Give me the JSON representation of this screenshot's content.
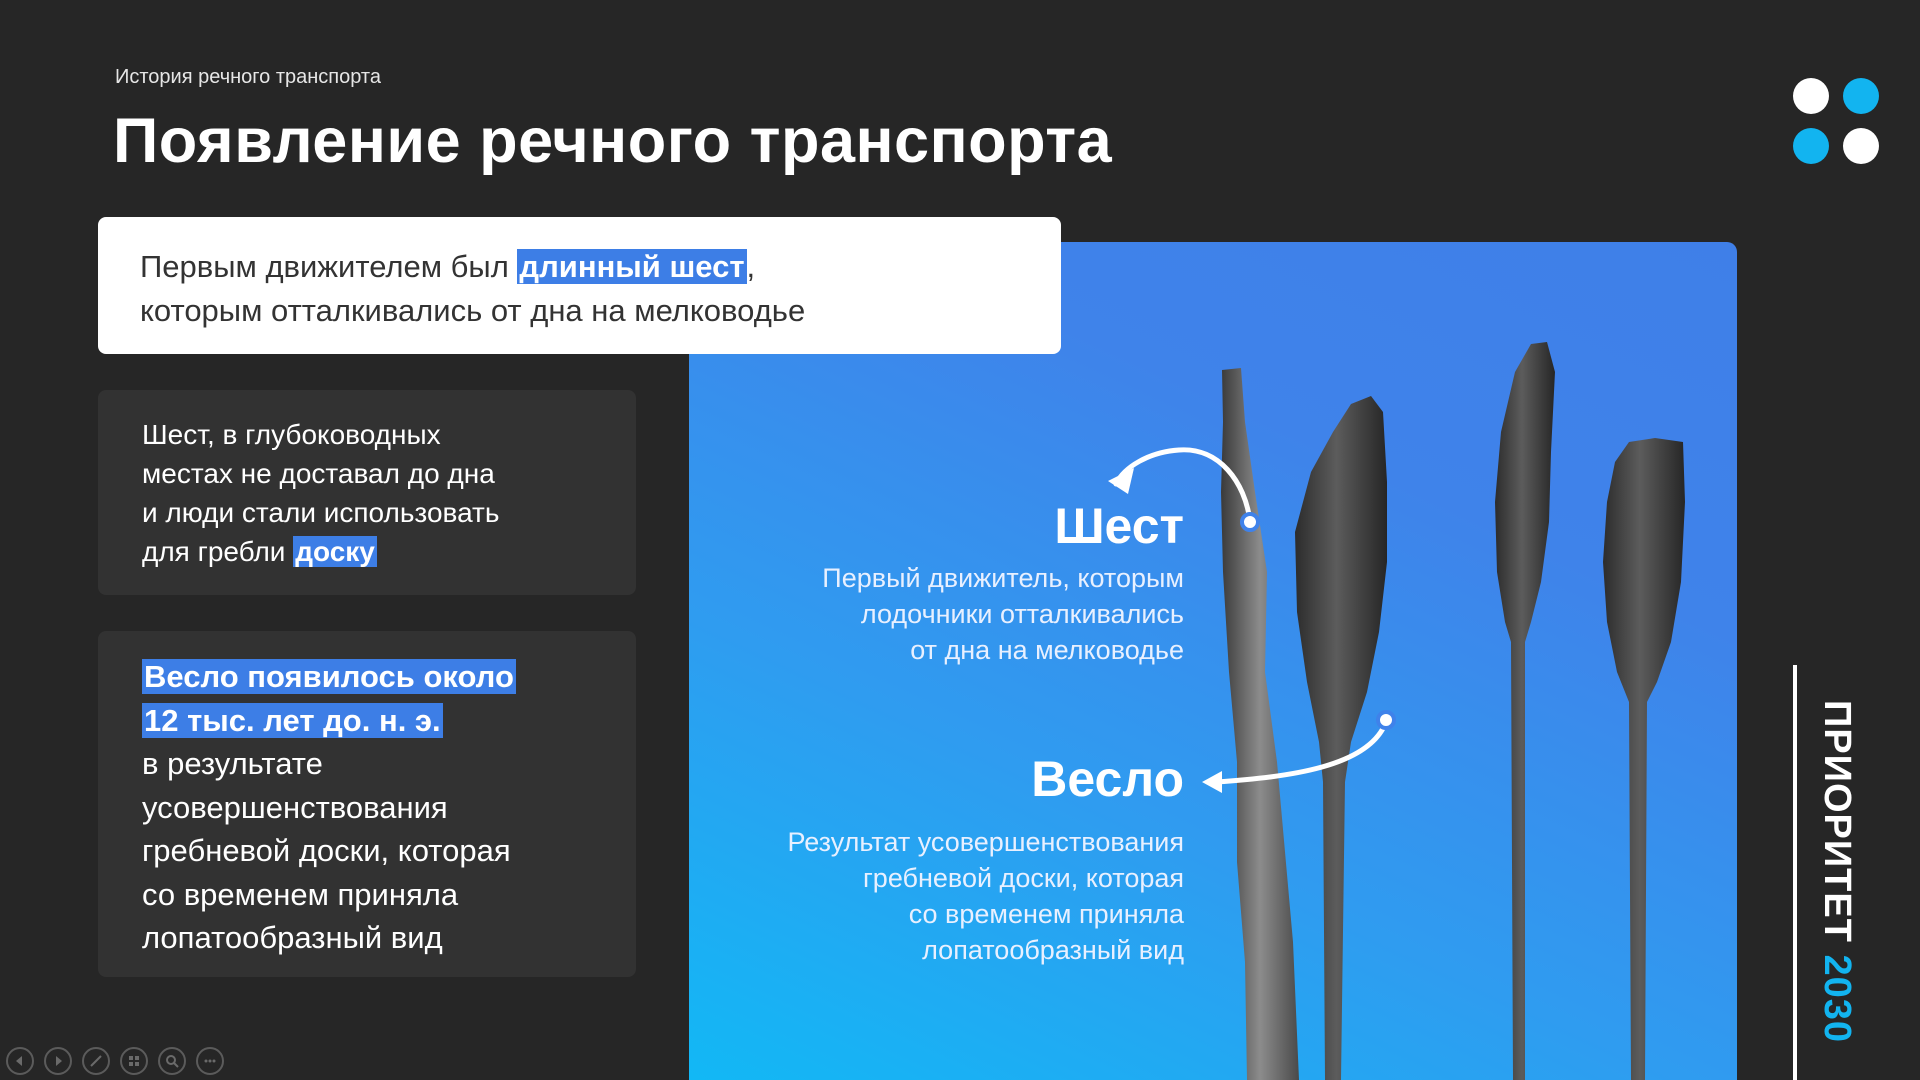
{
  "slide": {
    "breadcrumb": "История речного транспорта",
    "title": "Появление речного транспорта",
    "highlight_card": {
      "before": "Первым движителем был ",
      "highlight": "длинный шест",
      "after_line1": ",",
      "line2": "которым отталкивались от дна на мелководье"
    },
    "card_board": {
      "line1": "Шест, в глубоководных",
      "line2": "местах не доставал до дна",
      "line3": "и люди стали использовать",
      "line4_before": "для гребли ",
      "line4_highlight": "доску"
    },
    "card_oar": {
      "highlight_line1": "Весло появилось около",
      "highlight_line2": "12 тыс. лет до. н. э.",
      "line3": "в результате",
      "line4": "усовершенствования",
      "line5": "гребневой доски, которая",
      "line6": "со временем приняла",
      "line7": "лопатообразный вид"
    },
    "pole_label": {
      "title": "Шест",
      "line1": "Первый движитель, которым",
      "line2": "лодочники отталкивались",
      "line3": "от дна на мелководье"
    },
    "oar_label": {
      "title": "Весло",
      "line1": "Результат усовершенствования",
      "line2": "гребневой доски, которая",
      "line3": "со временем приняла",
      "line4": "лопатообразный вид"
    },
    "brand": {
      "word": "ПРИОРИТЕТ",
      "year": "2030"
    }
  },
  "colors": {
    "background": "#262626",
    "card_dark": "#323232",
    "accent_blue": "#3d7ee6",
    "accent_cyan": "#12b4f0",
    "white": "#ffffff"
  },
  "controls": {
    "icons": [
      "prev-arrow-icon",
      "next-arrow-icon",
      "pen-icon",
      "slides-grid-icon",
      "zoom-icon",
      "more-icon"
    ]
  }
}
